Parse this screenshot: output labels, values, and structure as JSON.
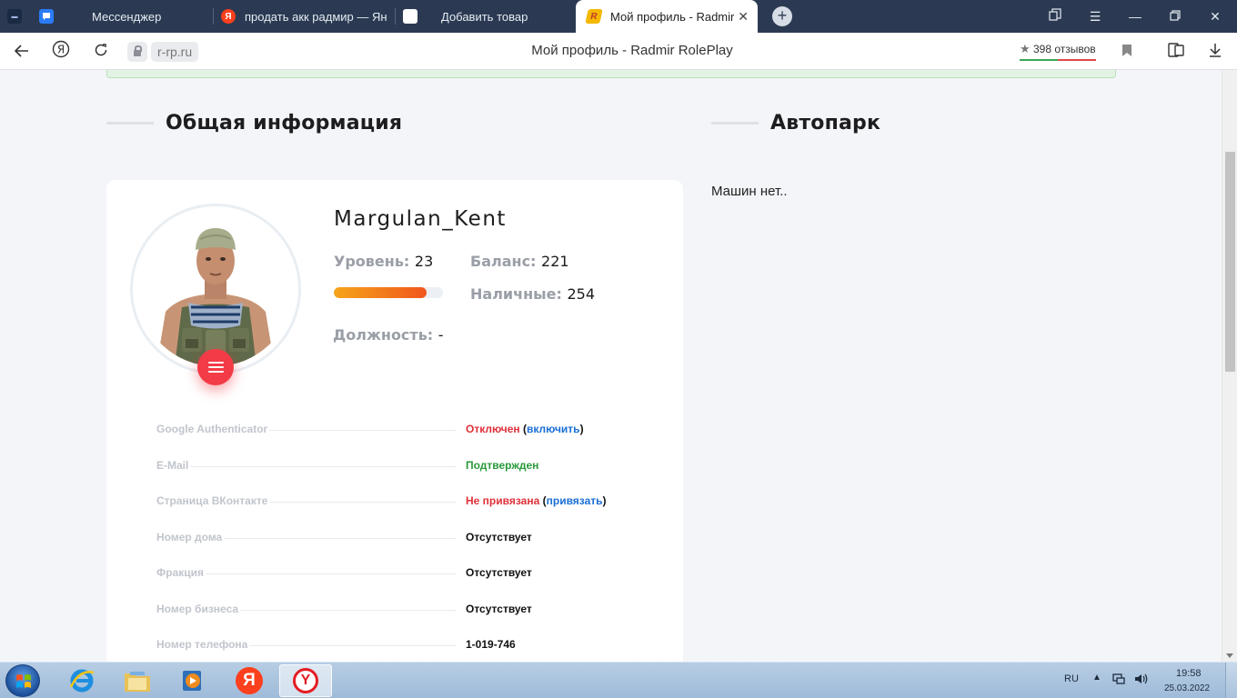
{
  "browser": {
    "tabs": [
      {
        "label": "Мессенджер",
        "icon": "messenger-icon",
        "color": "#2a7cf7"
      },
      {
        "label": "продать акк радмир — Ян",
        "icon": "yandex-icon",
        "color": "#fc3f1d"
      },
      {
        "label": "Добавить товар",
        "icon": "blank-page-icon",
        "color": "#ffffff"
      },
      {
        "label": "Мой профиль - Radmir",
        "icon": "radmir-icon",
        "color": "#f5b800",
        "active": true
      }
    ],
    "address": {
      "domain": "r-rp.ru",
      "page_title": "Мой профиль - Radmir RolePlay",
      "reviews_star": "★",
      "reviews_label": "398 отзывов"
    }
  },
  "page": {
    "sections": {
      "general_title": "Общая информация",
      "cars_title": "Автопарк"
    },
    "cars_empty": "Машин нет..",
    "profile": {
      "username": "Margulan_Kent",
      "level_label": "Уровень:",
      "level_value": "23",
      "level_progress": 0.85,
      "balance_label": "Баланс:",
      "balance_value": "221",
      "cash_label": "Наличные:",
      "cash_value": "254",
      "position_label": "Должность:",
      "position_value": "-"
    },
    "info_rows": [
      {
        "label": "Google Authenticator",
        "value": "Отключен",
        "value_class": "red",
        "link": "включить"
      },
      {
        "label": "E-Mail",
        "value": "Подтвержден",
        "value_class": "green"
      },
      {
        "label": "Страница ВКонтакте",
        "value": "Не привязана",
        "value_class": "red",
        "link": "привязать"
      },
      {
        "label": "Номер дома",
        "value": "Отсутствует"
      },
      {
        "label": "Фракция",
        "value": "Отсутствует"
      },
      {
        "label": "Номер бизнеса",
        "value": "Отсутствует"
      },
      {
        "label": "Номер телефона",
        "value": "1-019-746"
      }
    ],
    "colors": {
      "accent_red": "#f23b46",
      "level_start": "#f6a51a",
      "level_end": "#f0561d",
      "link_blue": "#1a6fd6"
    }
  },
  "taskbar": {
    "lang": "RU",
    "time": "19:58",
    "date": "25.03.2022",
    "yandex_letter": "Я",
    "yandex_browser_letter": "Y"
  }
}
